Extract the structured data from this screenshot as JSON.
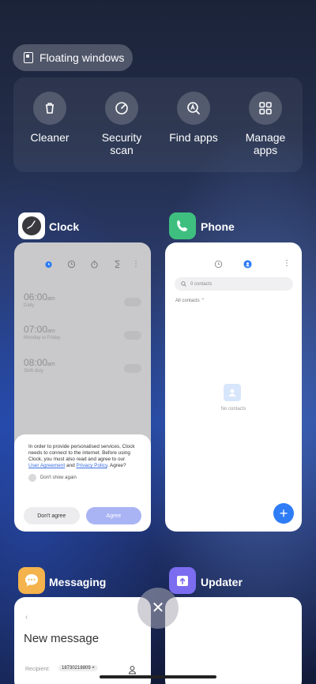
{
  "floating_windows": {
    "label": "Floating windows",
    "icon": "floating-window-icon"
  },
  "tools": [
    {
      "label": "Cleaner",
      "icon": "trash-icon"
    },
    {
      "label": "Security scan",
      "icon": "shield-scan-icon"
    },
    {
      "label": "Find apps",
      "icon": "find-apps-icon"
    },
    {
      "label": "Manage apps",
      "icon": "grid-icon"
    }
  ],
  "apps": {
    "clock": {
      "name": "Clock",
      "alarms": [
        {
          "time": "06:00",
          "ampm": "am",
          "repeat": "Daily"
        },
        {
          "time": "07:00",
          "ampm": "am",
          "repeat": "Monday to Friday"
        },
        {
          "time": "08:00",
          "ampm": "am",
          "repeat": "Shift duty"
        }
      ],
      "dialog": {
        "message": "In order to provide personalised services, Clock needs to connect to the internet. Before using Clock, you must also read and agree to our",
        "link1": "User Agreement",
        "and": "and",
        "link2": "Privacy Policy",
        "question": ". Agree?",
        "checkbox": "Don't show again",
        "disagree": "Don't agree",
        "agree": "Agree"
      }
    },
    "phone": {
      "name": "Phone",
      "search_placeholder": "0 contacts",
      "filter": "All contacts",
      "empty": "No contacts",
      "fab": "+"
    },
    "messaging": {
      "name": "Messaging",
      "title": "New message",
      "recipient_label": "Recipient:",
      "recipient_chip": "18730218809"
    },
    "updater": {
      "name": "Updater"
    }
  },
  "close_button": "✕",
  "colors": {
    "accent": "#2e7cf6",
    "agree_button": "#a9b4f4",
    "phone_icon": "#3fbf7f",
    "messaging_icon": "#f4b34c",
    "updater_icon": "#7b6cf0"
  }
}
